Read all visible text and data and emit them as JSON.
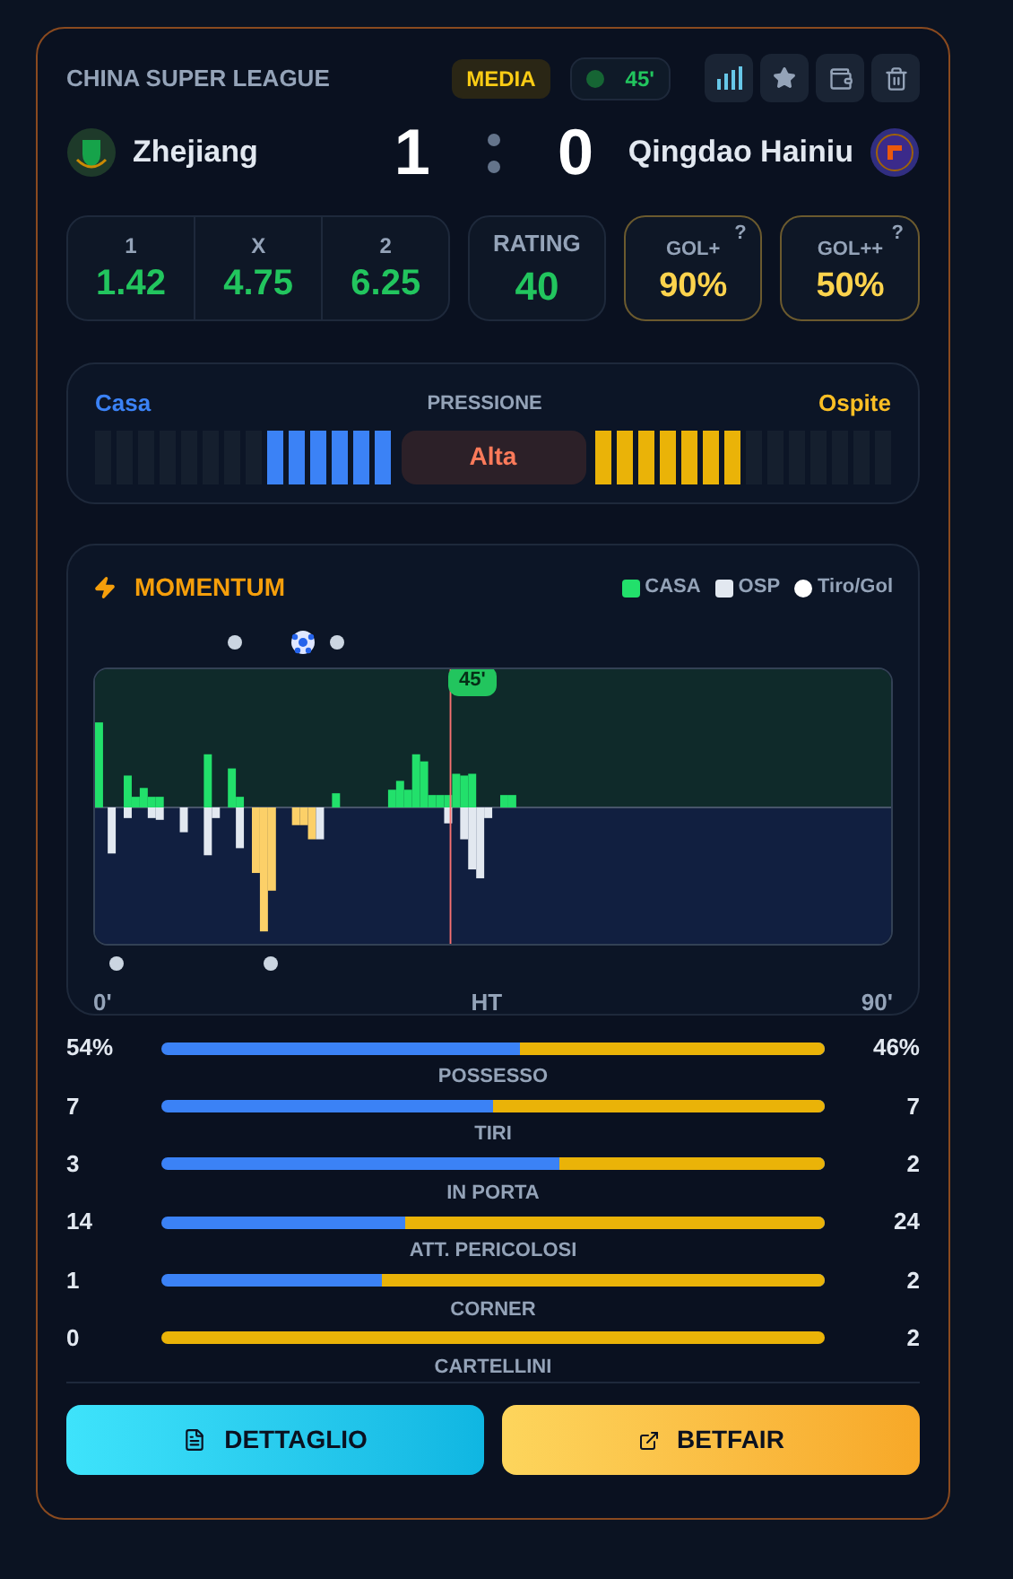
{
  "league": "CHINA SUPER LEAGUE",
  "badge": "MEDIA",
  "live": {
    "minute": "45'"
  },
  "home": {
    "name": "Zhejiang",
    "score": "1"
  },
  "away": {
    "name": "Qingdao Hainiu",
    "score": "0"
  },
  "odds": [
    {
      "label": "1",
      "value": "1.42"
    },
    {
      "label": "X",
      "value": "4.75"
    },
    {
      "label": "2",
      "value": "6.25"
    }
  ],
  "rating": {
    "label": "RATING",
    "value": "40"
  },
  "goal_probs": [
    {
      "label": "GOL+",
      "value": "90%",
      "help": "?"
    },
    {
      "label": "GOL++",
      "value": "50%",
      "help": "?"
    }
  ],
  "pressure": {
    "home_label": "Casa",
    "title": "PRESSIONE",
    "away_label": "Ospite",
    "home": {
      "level": 0.43
    },
    "away": {
      "level": 0.5
    },
    "value": "Alta"
  },
  "momentum": {
    "title": "MOMENTUM",
    "legend": [
      {
        "label": "CASA",
        "color": "#22e06b",
        "kind": "square"
      },
      {
        "label": "OSP",
        "color": "#e2e8f0",
        "kind": "square"
      },
      {
        "label": "Tiro/Gol",
        "color": "#ffffff",
        "kind": "dot"
      }
    ],
    "marker": "45'",
    "x_labels": [
      "0'",
      "HT",
      "90'"
    ]
  },
  "stats": [
    {
      "home": "54%",
      "label": "POSSESSO",
      "away": "46%",
      "level": 0.46
    },
    {
      "home": "7",
      "label": "TIRI",
      "away": "7",
      "level": 0.5
    },
    {
      "home": "3",
      "label": "IN PORTA",
      "away": "2",
      "level": 0.4
    },
    {
      "home": "14",
      "label": "ATT. PERICOLOSI",
      "away": "24",
      "level": 0.632
    },
    {
      "home": "1",
      "label": "CORNER",
      "away": "2",
      "level": 0.667
    },
    {
      "home": "0",
      "label": "CARTELLINI",
      "away": "2",
      "level": 1
    }
  ],
  "buttons": [
    {
      "label": "DETTAGLIO",
      "kind": "detail"
    },
    {
      "label": "BETFAIR",
      "kind": "external"
    }
  ]
}
